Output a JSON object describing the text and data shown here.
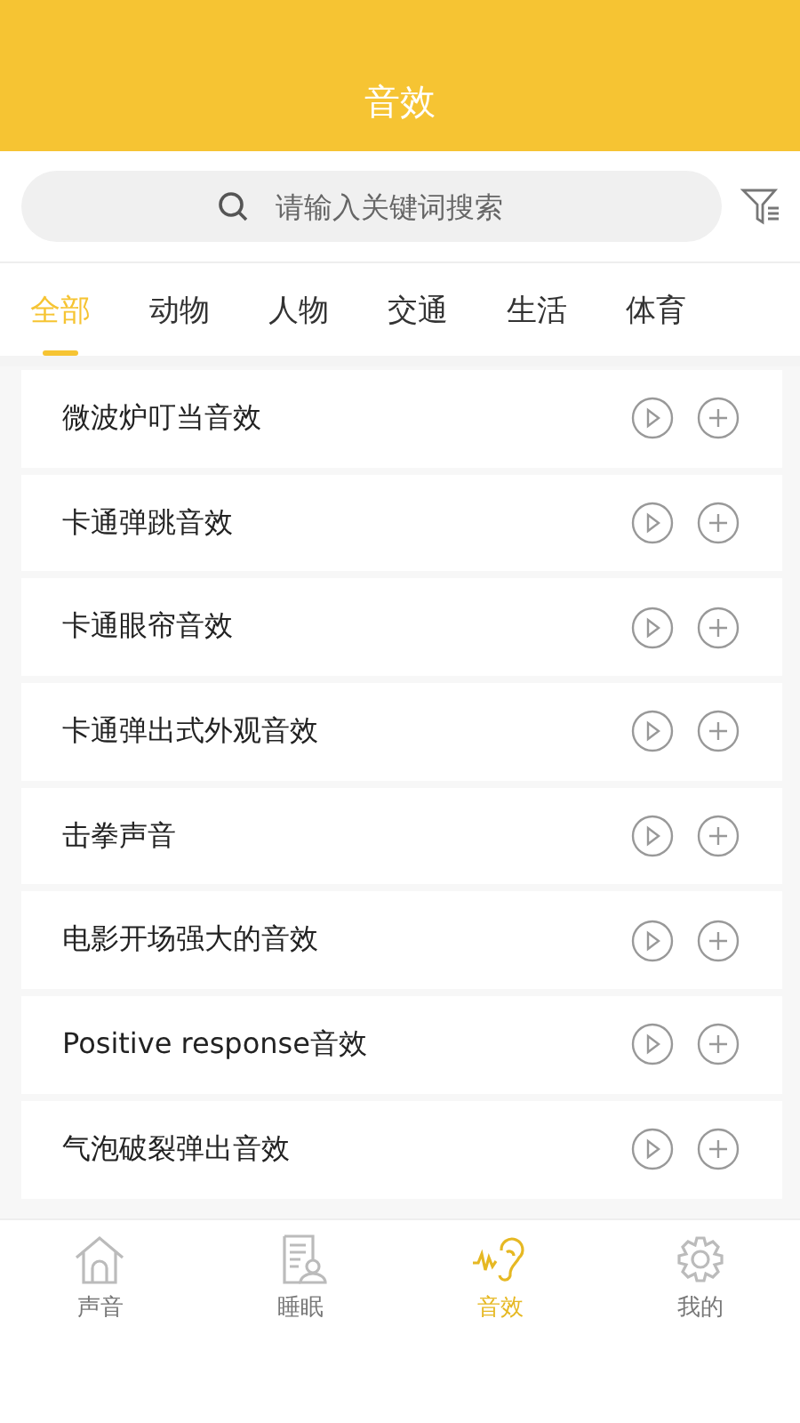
{
  "header": {
    "title": "音效"
  },
  "search": {
    "placeholder": "请输入关键词搜索"
  },
  "tabs": [
    {
      "label": "全部",
      "selected": true
    },
    {
      "label": "动物",
      "selected": false
    },
    {
      "label": "人物",
      "selected": false
    },
    {
      "label": "交通",
      "selected": false
    },
    {
      "label": "生活",
      "selected": false
    },
    {
      "label": "体育",
      "selected": false
    }
  ],
  "sounds": [
    {
      "name": "微波炉叮当音效"
    },
    {
      "name": "卡通弹跳音效"
    },
    {
      "name": "卡通眼帘音效"
    },
    {
      "name": "卡通弹出式外观音效"
    },
    {
      "name": "击拳声音"
    },
    {
      "name": "电影开场强大的音效"
    },
    {
      "name": "Positive response音效"
    },
    {
      "name": "气泡破裂弹出音效"
    }
  ],
  "nav": [
    {
      "label": "声音",
      "kind": "home",
      "selected": false
    },
    {
      "label": "睡眠",
      "kind": "sleep",
      "selected": false
    },
    {
      "label": "音效",
      "kind": "ear",
      "selected": true
    },
    {
      "label": "我的",
      "kind": "gear",
      "selected": false
    }
  ]
}
